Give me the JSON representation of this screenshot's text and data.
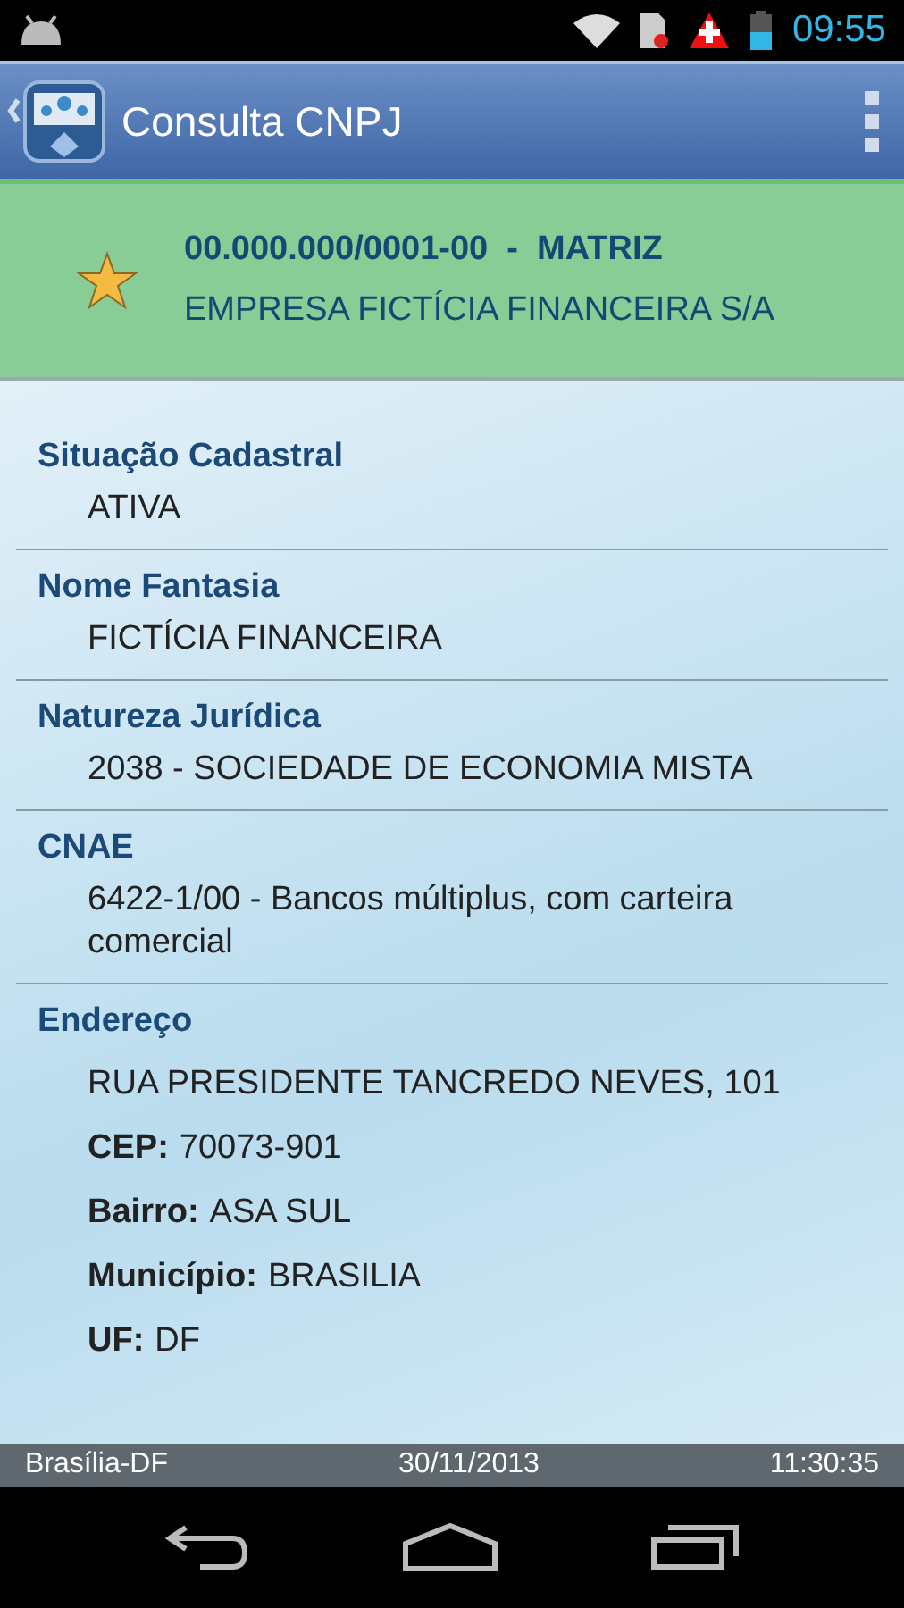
{
  "status_bar": {
    "time": "09:55"
  },
  "action_bar": {
    "title": "Consulta CNPJ"
  },
  "header": {
    "favorite": true,
    "cnpj": "00.000.000/0001-00  -  MATRIZ",
    "name": "EMPRESA FICTÍCIA FINANCEIRA S/A"
  },
  "sections": [
    {
      "title": "Situação Cadastral",
      "lines": [
        {
          "value": "ATIVA"
        }
      ]
    },
    {
      "title": "Nome Fantasia",
      "lines": [
        {
          "value": "FICTÍCIA FINANCEIRA"
        }
      ]
    },
    {
      "title": "Natureza Jurídica",
      "lines": [
        {
          "value": "2038 - SOCIEDADE DE ECONOMIA MISTA"
        }
      ]
    },
    {
      "title": "CNAE",
      "lines": [
        {
          "value": "6422-1/00 - Bancos múltiplus, com carteira comercial"
        }
      ]
    },
    {
      "title": "Endereço",
      "lines": [
        {
          "value": "RUA PRESIDENTE TANCREDO NEVES, 101"
        },
        {
          "label": "CEP:",
          "value": "70073-901"
        },
        {
          "label": "Bairro:",
          "value": "ASA SUL"
        },
        {
          "label": "Município:",
          "value": "BRASILIA"
        },
        {
          "label": "UF:",
          "value": "DF"
        }
      ]
    }
  ],
  "footer": {
    "location": "Brasília-DF",
    "date": "30/11/2013",
    "time": "11:30:35"
  }
}
